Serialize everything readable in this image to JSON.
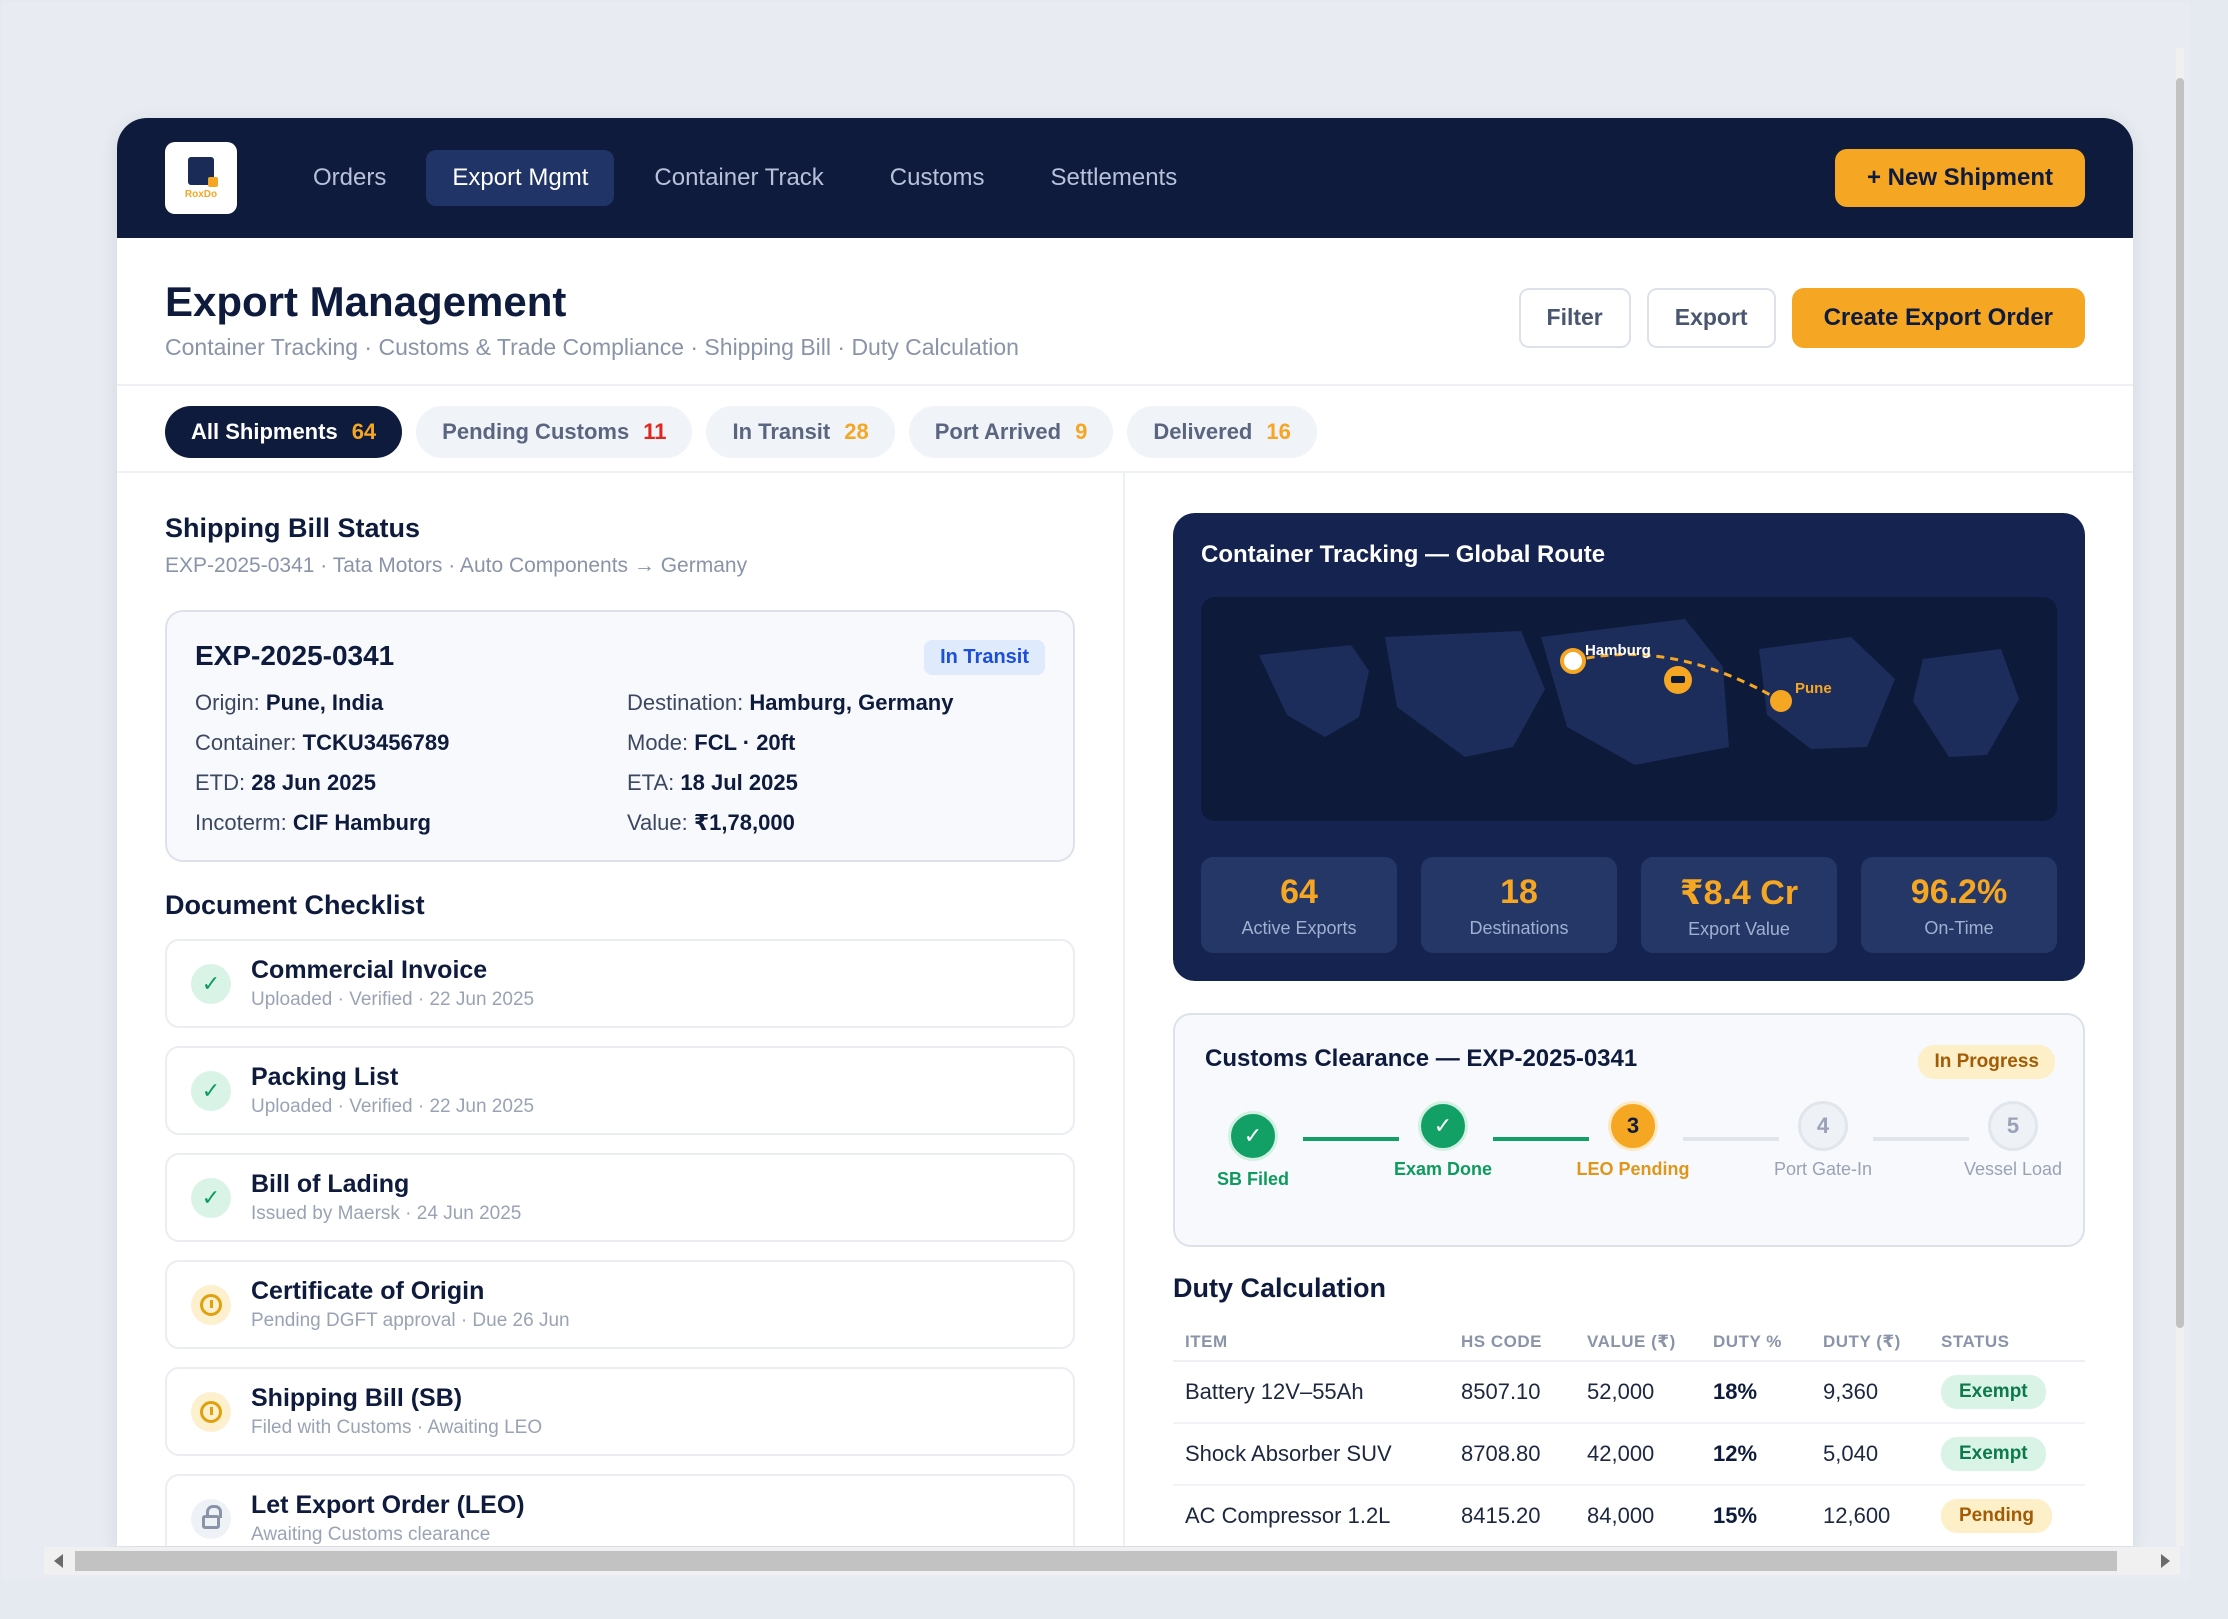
{
  "nav": {
    "logo_text": "RoxDo",
    "items": [
      {
        "label": "Orders",
        "active": false
      },
      {
        "label": "Export Mgmt",
        "active": true
      },
      {
        "label": "Container Track",
        "active": false
      },
      {
        "label": "Customs",
        "active": false
      },
      {
        "label": "Settlements",
        "active": false
      }
    ],
    "new_shipment_label": "+ New Shipment"
  },
  "header": {
    "title": "Export Management",
    "subtitle": "Container Tracking · Customs & Trade Compliance · Shipping Bill · Duty Calculation",
    "filter_label": "Filter",
    "export_label": "Export",
    "create_label": "Create Export Order"
  },
  "tabs": [
    {
      "label": "All Shipments",
      "count": "64",
      "active": true
    },
    {
      "label": "Pending Customs",
      "count": "11",
      "active": false
    },
    {
      "label": "In Transit",
      "count": "28",
      "active": false
    },
    {
      "label": "Port Arrived",
      "count": "9",
      "active": false
    },
    {
      "label": "Delivered",
      "count": "16",
      "active": false
    }
  ],
  "shipping_bill": {
    "title": "Shipping Bill Status",
    "subtitle": "EXP-2025-0341 · Tata Motors · Auto Components → Germany",
    "id": "EXP-2025-0341",
    "status": "In Transit",
    "fields": [
      {
        "label": "Origin:",
        "value": "Pune, India"
      },
      {
        "label": "Destination:",
        "value": "Hamburg, Germany"
      },
      {
        "label": "Container:",
        "value": "TCKU3456789"
      },
      {
        "label": "Mode:",
        "value": "FCL · 20ft"
      },
      {
        "label": "ETD:",
        "value": "28 Jun 2025"
      },
      {
        "label": "ETA:",
        "value": "18 Jul 2025"
      },
      {
        "label": "Incoterm:",
        "value": "CIF Hamburg"
      },
      {
        "label": "Value:",
        "value": "₹1,78,000"
      }
    ]
  },
  "documents": {
    "title": "Document Checklist",
    "items": [
      {
        "name": "Commercial Invoice",
        "meta": "Uploaded · Verified · 22 Jun 2025",
        "state": "done",
        "icon": "check-icon"
      },
      {
        "name": "Packing List",
        "meta": "Uploaded · Verified · 22 Jun 2025",
        "state": "done",
        "icon": "check-icon"
      },
      {
        "name": "Bill of Lading",
        "meta": "Issued by Maersk · 24 Jun 2025",
        "state": "done",
        "icon": "check-icon"
      },
      {
        "name": "Certificate of Origin",
        "meta": "Pending DGFT approval · Due 26 Jun",
        "state": "pending",
        "icon": "clock-icon"
      },
      {
        "name": "Shipping Bill (SB)",
        "meta": "Filed with Customs · Awaiting LEO",
        "state": "pending",
        "icon": "clock-icon"
      },
      {
        "name": "Let Export Order (LEO)",
        "meta": "Awaiting Customs clearance",
        "state": "locked",
        "icon": "lock-icon"
      }
    ]
  },
  "tracking": {
    "title": "Container Tracking — Global Route",
    "origin_label": "Pune",
    "destination_label": "Hamburg",
    "stats": [
      {
        "value": "64",
        "label": "Active Exports"
      },
      {
        "value": "18",
        "label": "Destinations"
      },
      {
        "value": "₹8.4 Cr",
        "label": "Export Value"
      },
      {
        "value": "96.2%",
        "label": "On-Time"
      }
    ]
  },
  "customs": {
    "title": "Customs Clearance — EXP-2025-0341",
    "status": "In Progress",
    "steps": [
      {
        "marker": "✓",
        "label": "SB Filed",
        "state": "done"
      },
      {
        "marker": "✓",
        "label": "Exam Done",
        "state": "done"
      },
      {
        "marker": "3",
        "label": "LEO Pending",
        "state": "current"
      },
      {
        "marker": "4",
        "label": "Port Gate-In",
        "state": "todo"
      },
      {
        "marker": "5",
        "label": "Vessel Load",
        "state": "todo"
      }
    ]
  },
  "duty": {
    "title": "Duty Calculation",
    "columns": [
      "ITEM",
      "HS CODE",
      "VALUE (₹)",
      "DUTY %",
      "DUTY (₹)",
      "STATUS"
    ],
    "rows": [
      {
        "item": "Battery 12V–55Ah",
        "hs": "8507.10",
        "value": "52,000",
        "pct": "18%",
        "duty": "9,360",
        "status": "Exempt",
        "status_kind": "exempt"
      },
      {
        "item": "Shock Absorber SUV",
        "hs": "8708.80",
        "value": "42,000",
        "pct": "12%",
        "duty": "5,040",
        "status": "Exempt",
        "status_kind": "exempt"
      },
      {
        "item": "AC Compressor 1.2L",
        "hs": "8415.20",
        "value": "84,000",
        "pct": "15%",
        "duty": "12,600",
        "status": "Pending",
        "status_kind": "pending"
      }
    ]
  },
  "colors": {
    "navy": "#0e1b3d",
    "accent": "#f5a623",
    "success": "#12a067",
    "info": "#1d4ed8"
  }
}
